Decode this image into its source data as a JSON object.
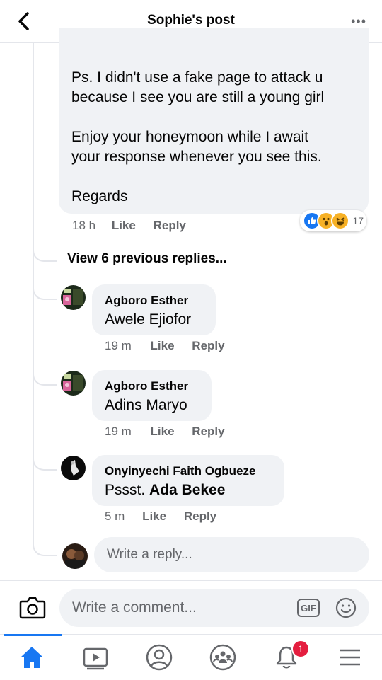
{
  "header": {
    "title": "Sophie's post",
    "more": "•••"
  },
  "main_comment": {
    "text": "Ps. I didn't use a fake page to attack u\nbecause I see you are still a young girl\n\nEnjoy your honeymoon while I await\nyour response whenever you see this.\n\nRegards",
    "time": "18 h",
    "like_label": "Like",
    "reply_label": "Reply",
    "reaction_count": "17",
    "reaction_icons": [
      "like-icon",
      "wow-icon",
      "haha-icon"
    ]
  },
  "view_previous": "View 6 previous replies...",
  "replies": [
    {
      "author": "Agboro Esther",
      "text": "Awele Ejiofor",
      "time": "19 m",
      "like_label": "Like",
      "reply_label": "Reply"
    },
    {
      "author": "Agboro Esther",
      "text": "Adins Maryo",
      "time": "19 m",
      "like_label": "Like",
      "reply_label": "Reply"
    },
    {
      "author": "Onyinyechi Faith Ogbueze",
      "text_prefix": "Pssst.",
      "text_tag": "Ada Bekee",
      "time": "5 m",
      "like_label": "Like",
      "reply_label": "Reply"
    }
  ],
  "reply_input": {
    "placeholder": "Write a reply..."
  },
  "composer": {
    "placeholder": "Write a comment...",
    "gif_label": "GIF"
  },
  "tabs": [
    "home-icon",
    "watch-icon",
    "profile-icon",
    "groups-icon",
    "notifications-icon",
    "menu-icon"
  ],
  "notifications_badge": "1",
  "colors": {
    "accent": "#1877f2",
    "bubble": "#f0f2f5",
    "secondary_text": "#65676b",
    "badge": "#e41e3f"
  }
}
